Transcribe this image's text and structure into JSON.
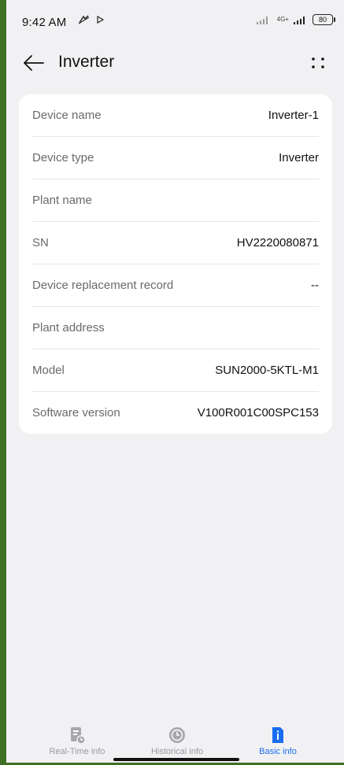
{
  "status": {
    "time": "9:42 AM",
    "network": "4G+",
    "battery": "80",
    "icons": [
      "pay-icon",
      "play-icon",
      "signal-icon"
    ]
  },
  "header": {
    "title": "Inverter",
    "back_icon": "back-arrow-icon",
    "more_icon": "more-dots-icon"
  },
  "rows": [
    {
      "label": "Device name",
      "value": "Inverter-1"
    },
    {
      "label": "Device type",
      "value": "Inverter"
    },
    {
      "label": "Plant name",
      "value": ""
    },
    {
      "label": "SN",
      "value": "HV2220080871"
    },
    {
      "label": "Device replacement record",
      "value": "--"
    },
    {
      "label": "Plant address",
      "value": ""
    },
    {
      "label": "Model",
      "value": "SUN2000-5KTL-M1"
    },
    {
      "label": "Software version",
      "value": "V100R001C00SPC153"
    }
  ],
  "nav": [
    {
      "label": "Real-Time info",
      "icon": "realtime-info-icon"
    },
    {
      "label": "Historical info",
      "icon": "history-clock-icon"
    },
    {
      "label": "Basic info",
      "icon": "info-document-icon"
    }
  ],
  "colors": {
    "accent": "#1a6cf2",
    "background": "#f1f1f3",
    "card": "#ffffff"
  }
}
